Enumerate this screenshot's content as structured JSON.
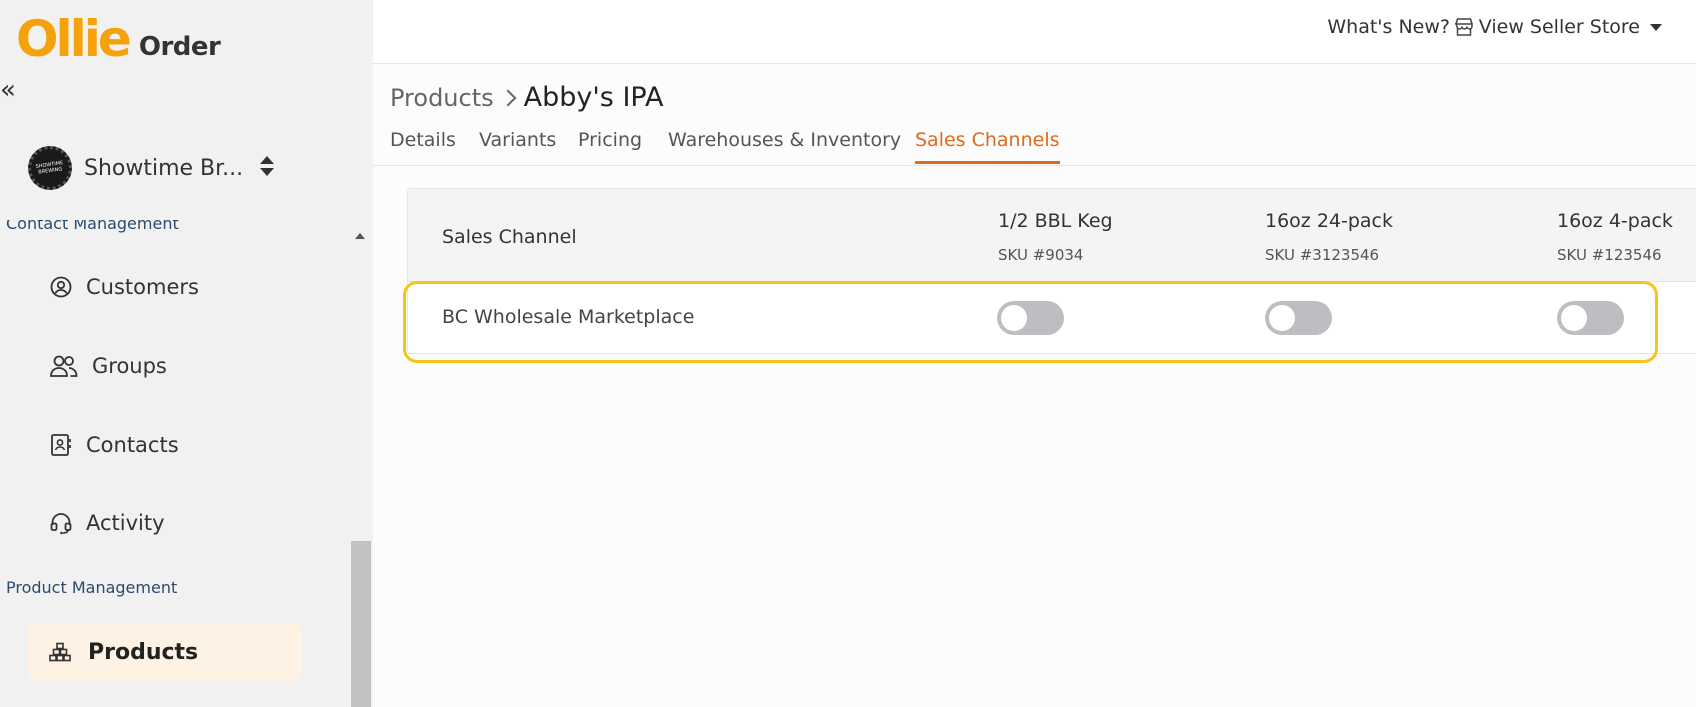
{
  "logo": {
    "brand": "Ollie",
    "product": "Order"
  },
  "sidebar": {
    "collapse_glyph": "«",
    "account": {
      "name": "Showtime Br...",
      "avatar_text": "SHOWTIME BREWING"
    },
    "sections": {
      "contact": "Contact Management",
      "product": "Product Management"
    },
    "items": [
      {
        "label": "Customers",
        "icon": "user-circle-icon"
      },
      {
        "label": "Groups",
        "icon": "users-icon"
      },
      {
        "label": "Contacts",
        "icon": "address-book-icon"
      },
      {
        "label": "Activity",
        "icon": "headset-icon"
      }
    ],
    "active": {
      "label": "Products",
      "icon": "boxes-icon"
    }
  },
  "topbar": {
    "whats_new": "What's New?",
    "view_store": "View Seller Store",
    "store_icon": "store-icon"
  },
  "breadcrumb": {
    "parent": "Products",
    "current": "Abby's IPA"
  },
  "tabs": [
    "Details",
    "Variants",
    "Pricing",
    "Warehouses & Inventory",
    "Sales Channels"
  ],
  "active_tab": "Sales Channels",
  "table": {
    "channel_header": "Sales Channel",
    "columns": [
      {
        "name": "1/2 BBL Keg",
        "sku": "SKU #9034"
      },
      {
        "name": "16oz 24-pack",
        "sku": "SKU #3123546"
      },
      {
        "name": "16oz 4-pack",
        "sku": "SKU #123546"
      }
    ],
    "rows": [
      {
        "channel": "BC Wholesale Marketplace",
        "enabled": [
          false,
          false,
          false
        ]
      }
    ]
  },
  "colors": {
    "accent": "#e06a1b",
    "logo": "#f5a10a",
    "highlight": "#f5c518",
    "active_bg": "#fdf2e3"
  }
}
